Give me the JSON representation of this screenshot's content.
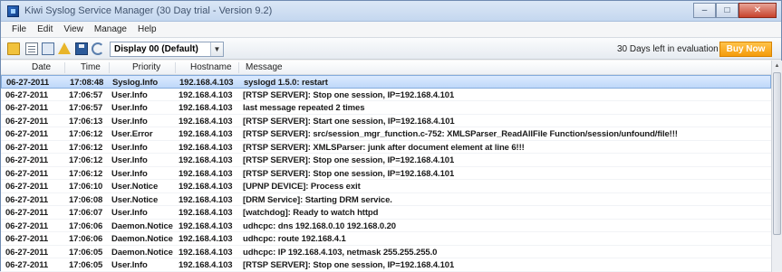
{
  "window": {
    "title": "Kiwi Syslog Service Manager (30 Day trial - Version 9.2)",
    "controls": {
      "minimize": "–",
      "maximize": "□",
      "close": "✕"
    }
  },
  "menu": [
    "File",
    "Edit",
    "View",
    "Manage",
    "Help"
  ],
  "toolbar": {
    "icons": [
      "open-folder-icon",
      "properties-icon",
      "view-icon",
      "alert-icon",
      "save-icon",
      "refresh-icon"
    ],
    "display_select": "Display 00 (Default)",
    "eval_text": "30 Days left in evaluation",
    "buy_label": "Buy Now",
    "buy_color": "#f49b0b"
  },
  "grid": {
    "headers": {
      "date": "Date",
      "time": "Time",
      "priority": "Priority",
      "hostname": "Hostname",
      "message": "Message"
    },
    "rows": [
      {
        "date": "06-27-2011",
        "time": "17:08:48",
        "priority": "Syslog.Info",
        "hostname": "192.168.4.103",
        "message": "syslogd 1.5.0: restart"
      },
      {
        "date": "06-27-2011",
        "time": "17:06:57",
        "priority": "User.Info",
        "hostname": "192.168.4.103",
        "message": "[RTSP SERVER]: Stop one session, IP=192.168.4.101"
      },
      {
        "date": "06-27-2011",
        "time": "17:06:57",
        "priority": "User.Info",
        "hostname": "192.168.4.103",
        "message": "last message repeated 2 times"
      },
      {
        "date": "06-27-2011",
        "time": "17:06:13",
        "priority": "User.Info",
        "hostname": "192.168.4.103",
        "message": "[RTSP SERVER]: Start one session, IP=192.168.4.101"
      },
      {
        "date": "06-27-2011",
        "time": "17:06:12",
        "priority": "User.Error",
        "hostname": "192.168.4.103",
        "message": "[RTSP SERVER]: src/session_mgr_function.c-752: XMLSParser_ReadAllFile Function/session/unfound/file!!!"
      },
      {
        "date": "06-27-2011",
        "time": "17:06:12",
        "priority": "User.Info",
        "hostname": "192.168.4.103",
        "message": "[RTSP SERVER]: XMLSParser: junk after document element at line 6!!!"
      },
      {
        "date": "06-27-2011",
        "time": "17:06:12",
        "priority": "User.Info",
        "hostname": "192.168.4.103",
        "message": "[RTSP SERVER]: Stop one session, IP=192.168.4.101"
      },
      {
        "date": "06-27-2011",
        "time": "17:06:12",
        "priority": "User.Info",
        "hostname": "192.168.4.103",
        "message": "[RTSP SERVER]: Stop one session, IP=192.168.4.101"
      },
      {
        "date": "06-27-2011",
        "time": "17:06:10",
        "priority": "User.Notice",
        "hostname": "192.168.4.103",
        "message": "[UPNP DEVICE]: Process exit"
      },
      {
        "date": "06-27-2011",
        "time": "17:06:08",
        "priority": "User.Notice",
        "hostname": "192.168.4.103",
        "message": "[DRM Service]: Starting DRM service."
      },
      {
        "date": "06-27-2011",
        "time": "17:06:07",
        "priority": "User.Info",
        "hostname": "192.168.4.103",
        "message": "[watchdog]: Ready to watch httpd"
      },
      {
        "date": "06-27-2011",
        "time": "17:06:06",
        "priority": "Daemon.Notice",
        "hostname": "192.168.4.103",
        "message": "udhcpc: dns 192.168.0.10 192.168.0.20"
      },
      {
        "date": "06-27-2011",
        "time": "17:06:06",
        "priority": "Daemon.Notice",
        "hostname": "192.168.4.103",
        "message": "udhcpc: route 192.168.4.1"
      },
      {
        "date": "06-27-2011",
        "time": "17:06:05",
        "priority": "Daemon.Notice",
        "hostname": "192.168.4.103",
        "message": "udhcpc: IP 192.168.4.103, netmask 255.255.255.0"
      },
      {
        "date": "06-27-2011",
        "time": "17:06:05",
        "priority": "User.Info",
        "hostname": "192.168.4.103",
        "message": "[RTSP SERVER]: Stop one session, IP=192.168.4.101"
      }
    ],
    "selected_index": 0
  }
}
